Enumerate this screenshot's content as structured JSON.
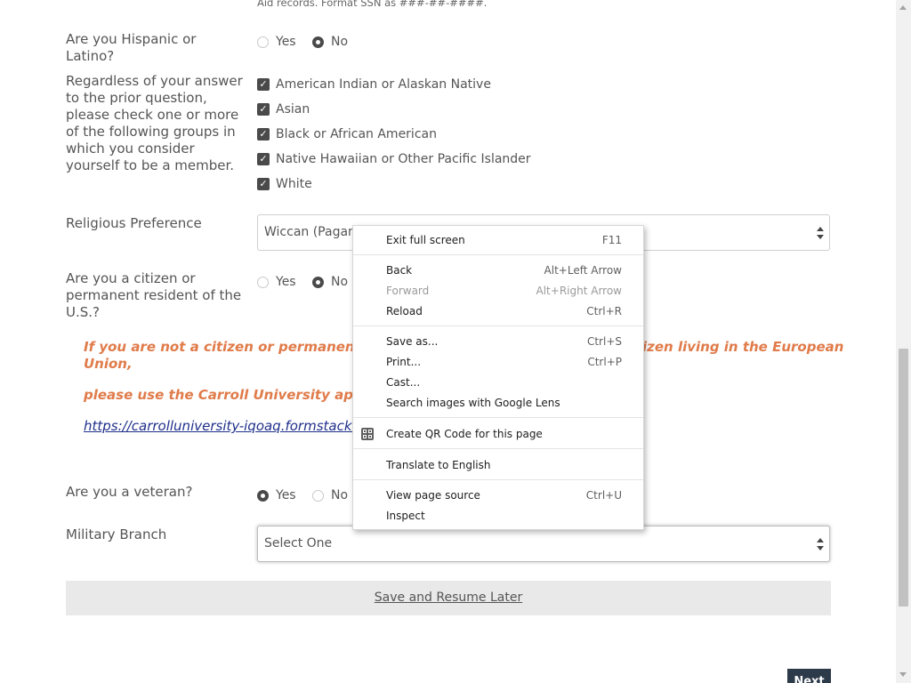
{
  "form": {
    "top_note": "Aid records. Format SSN as ###-##-####.",
    "hispanic": {
      "label": "Are you Hispanic or Latino?",
      "yes": "Yes",
      "no": "No",
      "selected": "No"
    },
    "race": {
      "label": "Regardless of your answer to the prior question, please check one or more of the following groups in which you consider yourself to be a member.",
      "options": [
        "American Indian or Alaskan Native",
        "Asian",
        "Black or African American",
        "Native Hawaiian or Other Pacific Islander",
        "White"
      ]
    },
    "religion": {
      "label": "Religious Preference",
      "value": "Wiccan (Pagan)"
    },
    "citizen": {
      "label": "Are you a citizen or permanent resident of the U.S.?",
      "yes": "Yes",
      "no": "No",
      "selected": "No"
    },
    "notice_line1": "If you are not a citizen or permanent resident",
    "notice_line1_end": "izen living in the European",
    "notice_line1b": "Union,",
    "notice_line2": "please use the Carroll University applicati",
    "notice_link": "https://carrolluniversity-iqoaq.formstack.co",
    "veteran": {
      "label": "Are you a veteran?",
      "yes": "Yes",
      "no": "No",
      "selected": "Yes"
    },
    "military": {
      "label": "Military Branch",
      "value": "Select One"
    },
    "save_label": "Save and Resume Later",
    "next_label": "Next"
  },
  "context_menu": {
    "items": [
      {
        "label": "Exit full screen",
        "shortcut": "F11"
      },
      {
        "label": "Back",
        "shortcut": "Alt+Left Arrow"
      },
      {
        "label": "Forward",
        "shortcut": "Alt+Right Arrow",
        "disabled": true
      },
      {
        "label": "Reload",
        "shortcut": "Ctrl+R"
      },
      {
        "label": "Save as...",
        "shortcut": "Ctrl+S"
      },
      {
        "label": "Print...",
        "shortcut": "Ctrl+P"
      },
      {
        "label": "Cast...",
        "shortcut": ""
      },
      {
        "label": "Search images with Google Lens",
        "shortcut": ""
      },
      {
        "label": "Create QR Code for this page",
        "shortcut": "",
        "icon": "qr-code-icon"
      },
      {
        "label": "Translate to English",
        "shortcut": ""
      },
      {
        "label": "View page source",
        "shortcut": "Ctrl+U"
      },
      {
        "label": "Inspect",
        "shortcut": ""
      }
    ]
  },
  "colors": {
    "accent_orange": "#e07b4a",
    "link_blue": "#1f2f8a",
    "control_dark": "#4a4a4a",
    "next_button": "#2d3a4a"
  }
}
